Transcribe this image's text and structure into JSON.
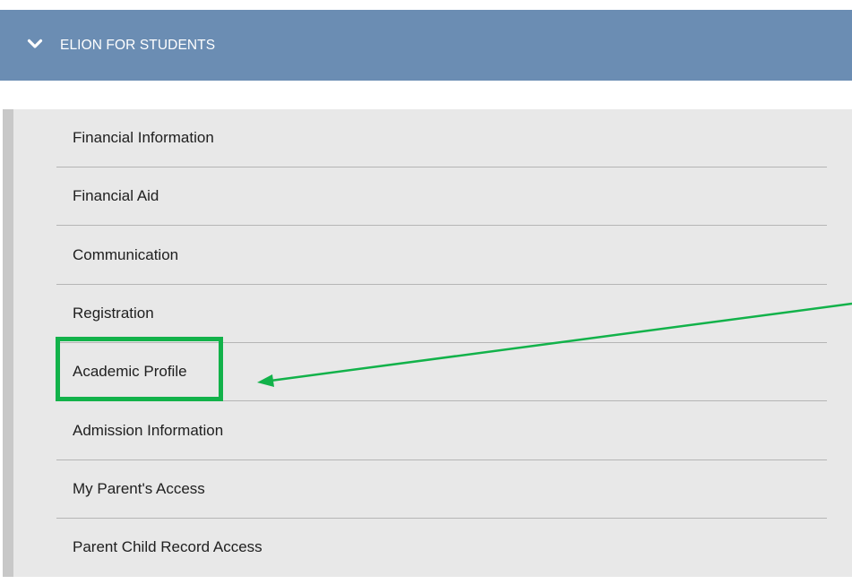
{
  "header": {
    "title": "ELION FOR STUDENTS",
    "icon": "chevron-down-icon"
  },
  "menu": {
    "items": [
      {
        "label": "Financial Information"
      },
      {
        "label": "Financial Aid"
      },
      {
        "label": "Communication"
      },
      {
        "label": "Registration"
      },
      {
        "label": "Academic Profile",
        "highlighted": true
      },
      {
        "label": "Admission Information"
      },
      {
        "label": "My Parent's Access"
      },
      {
        "label": "Parent Child Record Access"
      }
    ]
  },
  "colors": {
    "header_bg": "#6b8db3",
    "menu_bg": "#e8e8e8",
    "highlight": "#12b24a"
  }
}
